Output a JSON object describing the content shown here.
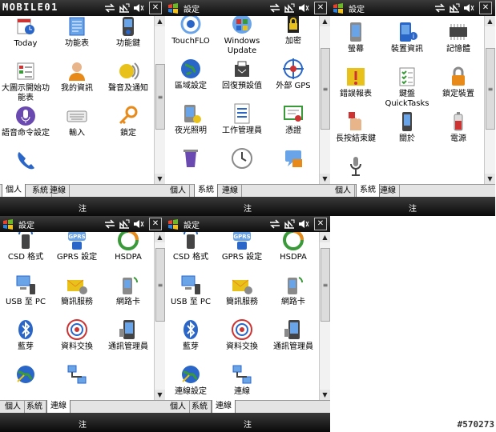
{
  "status_icons": [
    "connectivity-icon",
    "signal-icon",
    "volume-icon"
  ],
  "close_label": "✕",
  "screens": [
    {
      "logo": "MOBILE01",
      "title": "",
      "items": [
        {
          "label": "Today",
          "icon": "today-icon"
        },
        {
          "label": "功能表",
          "icon": "menu-icon"
        },
        {
          "label": "功能鍵",
          "icon": "buttons-icon"
        },
        {
          "label": "大圖示開始功能表",
          "icon": "start-menu-icon"
        },
        {
          "label": "我的資訊",
          "icon": "owner-info-icon"
        },
        {
          "label": "聲音及通知",
          "icon": "sounds-icon"
        },
        {
          "label": "語音命令設定",
          "icon": "voice-command-icon"
        },
        {
          "label": "輸入",
          "icon": "keyboard-input-icon"
        },
        {
          "label": "鎖定",
          "icon": "key-lock-icon"
        },
        {
          "label": "",
          "icon": "phone-icon"
        }
      ],
      "tabs": [
        "個人",
        "系統",
        "連線"
      ],
      "active_tab": 0,
      "softkey": "注"
    },
    {
      "logo": "",
      "title": "設定",
      "items": [
        {
          "label": "TouchFLO",
          "icon": "touchflo-icon"
        },
        {
          "label": "Windows Update",
          "icon": "windows-update-icon"
        },
        {
          "label": "加密",
          "icon": "encryption-icon"
        },
        {
          "label": "區域設定",
          "icon": "globe-icon"
        },
        {
          "label": "回復預設值",
          "icon": "reset-icon"
        },
        {
          "label": "外部 GPS",
          "icon": "gps-icon"
        },
        {
          "label": "夜光照明",
          "icon": "backlight-icon"
        },
        {
          "label": "工作管理員",
          "icon": "task-manager-icon"
        },
        {
          "label": "憑證",
          "icon": "certificate-icon"
        },
        {
          "label": "",
          "icon": "remove-programs-icon"
        },
        {
          "label": "",
          "icon": "clock-icon"
        },
        {
          "label": "",
          "icon": "customer-feedback-icon"
        }
      ],
      "tabs": [
        "個人",
        "系統",
        "連線"
      ],
      "active_tab": 1,
      "softkey": "注"
    },
    {
      "logo": "",
      "title": "設定",
      "items": [
        {
          "label": "螢幕",
          "icon": "screen-icon"
        },
        {
          "label": "裝置資訊",
          "icon": "device-info-icon"
        },
        {
          "label": "記憶體",
          "icon": "memory-icon"
        },
        {
          "label": "錯誤報表",
          "icon": "error-report-icon"
        },
        {
          "label": "鍵盤 QuickTasks",
          "icon": "quicktasks-icon"
        },
        {
          "label": "鎖定裝置",
          "icon": "padlock-icon"
        },
        {
          "label": "長按結束鍵",
          "icon": "end-key-icon"
        },
        {
          "label": "關於",
          "icon": "about-icon"
        },
        {
          "label": "電源",
          "icon": "battery-icon"
        },
        {
          "label": "",
          "icon": "microphone-icon"
        }
      ],
      "tabs": [
        "個人",
        "系統",
        "連線"
      ],
      "active_tab": 1,
      "softkey": "注"
    },
    {
      "logo": "",
      "title": "設定",
      "items": [
        {
          "label": "CSD 格式",
          "icon": "csd-icon"
        },
        {
          "label": "GPRS 設定",
          "icon": "gprs-icon"
        },
        {
          "label": "HSDPA",
          "icon": "hsdpa-icon"
        },
        {
          "label": "USB 至 PC",
          "icon": "usb-pc-icon"
        },
        {
          "label": "簡訊服務",
          "icon": "sms-service-icon"
        },
        {
          "label": "網路卡",
          "icon": "network-card-icon"
        },
        {
          "label": "藍芽",
          "icon": "bluetooth-icon"
        },
        {
          "label": "資料交換",
          "icon": "beam-icon"
        },
        {
          "label": "通訊管理員",
          "icon": "comm-manager-icon"
        },
        {
          "label": "",
          "icon": "connections-setup-icon"
        },
        {
          "label": "",
          "icon": "connections-icon"
        }
      ],
      "tabs": [
        "個人",
        "系統",
        "連線"
      ],
      "active_tab": 2,
      "softkey": "注"
    },
    {
      "logo": "",
      "title": "設定",
      "items": [
        {
          "label": "CSD 格式",
          "icon": "csd-icon"
        },
        {
          "label": "GPRS 設定",
          "icon": "gprs-icon"
        },
        {
          "label": "HSDPA",
          "icon": "hsdpa-icon"
        },
        {
          "label": "USB 至 PC",
          "icon": "usb-pc-icon"
        },
        {
          "label": "簡訊服務",
          "icon": "sms-service-icon"
        },
        {
          "label": "網路卡",
          "icon": "network-card-icon"
        },
        {
          "label": "藍芽",
          "icon": "bluetooth-icon"
        },
        {
          "label": "資料交換",
          "icon": "beam-icon"
        },
        {
          "label": "通訊管理員",
          "icon": "comm-manager-icon"
        },
        {
          "label": "連線設定",
          "icon": "connections-setup-icon"
        },
        {
          "label": "連線",
          "icon": "connections-icon"
        }
      ],
      "tabs": [
        "個人",
        "系統",
        "連線"
      ],
      "active_tab": 2,
      "softkey": "注"
    }
  ],
  "watermark": "#570273"
}
